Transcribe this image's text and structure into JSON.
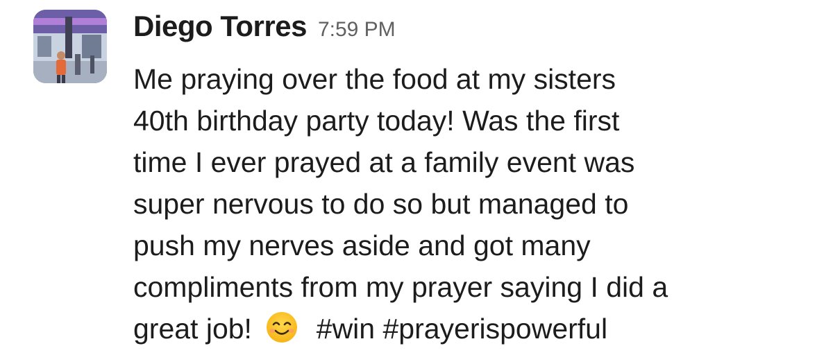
{
  "message": {
    "author": "Diego Torres",
    "timestamp": "7:59 PM",
    "lines": [
      "Me praying over the food at my sisters",
      "40th birthday party today! Was the first",
      "time I ever prayed at a family event was",
      "super nervous to do so but managed to",
      "push my nerves aside and got many",
      "compliments from my prayer saying I did a"
    ],
    "last_line_start": "great job!",
    "emoji": "smiling-face-icon",
    "hashtags": [
      "#win",
      "#prayerispowerful"
    ]
  },
  "colors": {
    "text": "#1d1c1d",
    "timestamp": "#616061",
    "emoji_face": "#fcc21b"
  }
}
